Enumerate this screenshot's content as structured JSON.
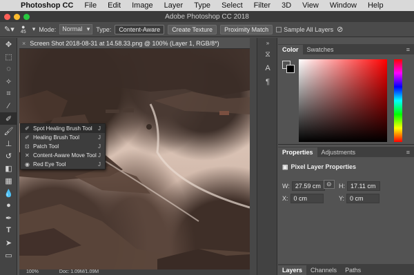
{
  "menubar": {
    "app": "Photoshop CC",
    "items": [
      "File",
      "Edit",
      "Image",
      "Layer",
      "Type",
      "Select",
      "Filter",
      "3D",
      "View",
      "Window",
      "Help"
    ]
  },
  "window_title": "Adobe Photoshop CC 2018",
  "options_bar": {
    "brush_size": "45",
    "mode_label": "Mode:",
    "mode_value": "Normal",
    "type_label": "Type:",
    "type_buttons": [
      "Content-Aware",
      "Create Texture",
      "Proximity Match"
    ],
    "sample_all_layers": "Sample All Layers"
  },
  "document": {
    "tab_title": "Screen Shot 2018-08-31 at 14.58.33.png @ 100% (Layer 1, RGB/8*)",
    "zoom": "100%",
    "doc_size": "Doc: 1.09M/1.09M"
  },
  "flyout": {
    "items": [
      {
        "label": "Spot Healing Brush Tool",
        "key": "J"
      },
      {
        "label": "Healing Brush Tool",
        "key": "J"
      },
      {
        "label": "Patch Tool",
        "key": "J"
      },
      {
        "label": "Content-Aware Move Tool",
        "key": "J"
      },
      {
        "label": "Red Eye Tool",
        "key": "J"
      }
    ]
  },
  "color_panel": {
    "tabs": [
      "Color",
      "Swatches"
    ]
  },
  "properties_panel": {
    "tabs": [
      "Properties",
      "Adjustments"
    ],
    "title": "Pixel Layer Properties",
    "w_label": "W:",
    "w_value": "27.59 cm",
    "h_label": "H:",
    "h_value": "17.11 cm",
    "x_label": "X:",
    "x_value": "0 cm",
    "y_label": "Y:",
    "y_value": "0 cm"
  },
  "layers_panel": {
    "tabs": [
      "Layers",
      "Channels",
      "Paths"
    ]
  }
}
